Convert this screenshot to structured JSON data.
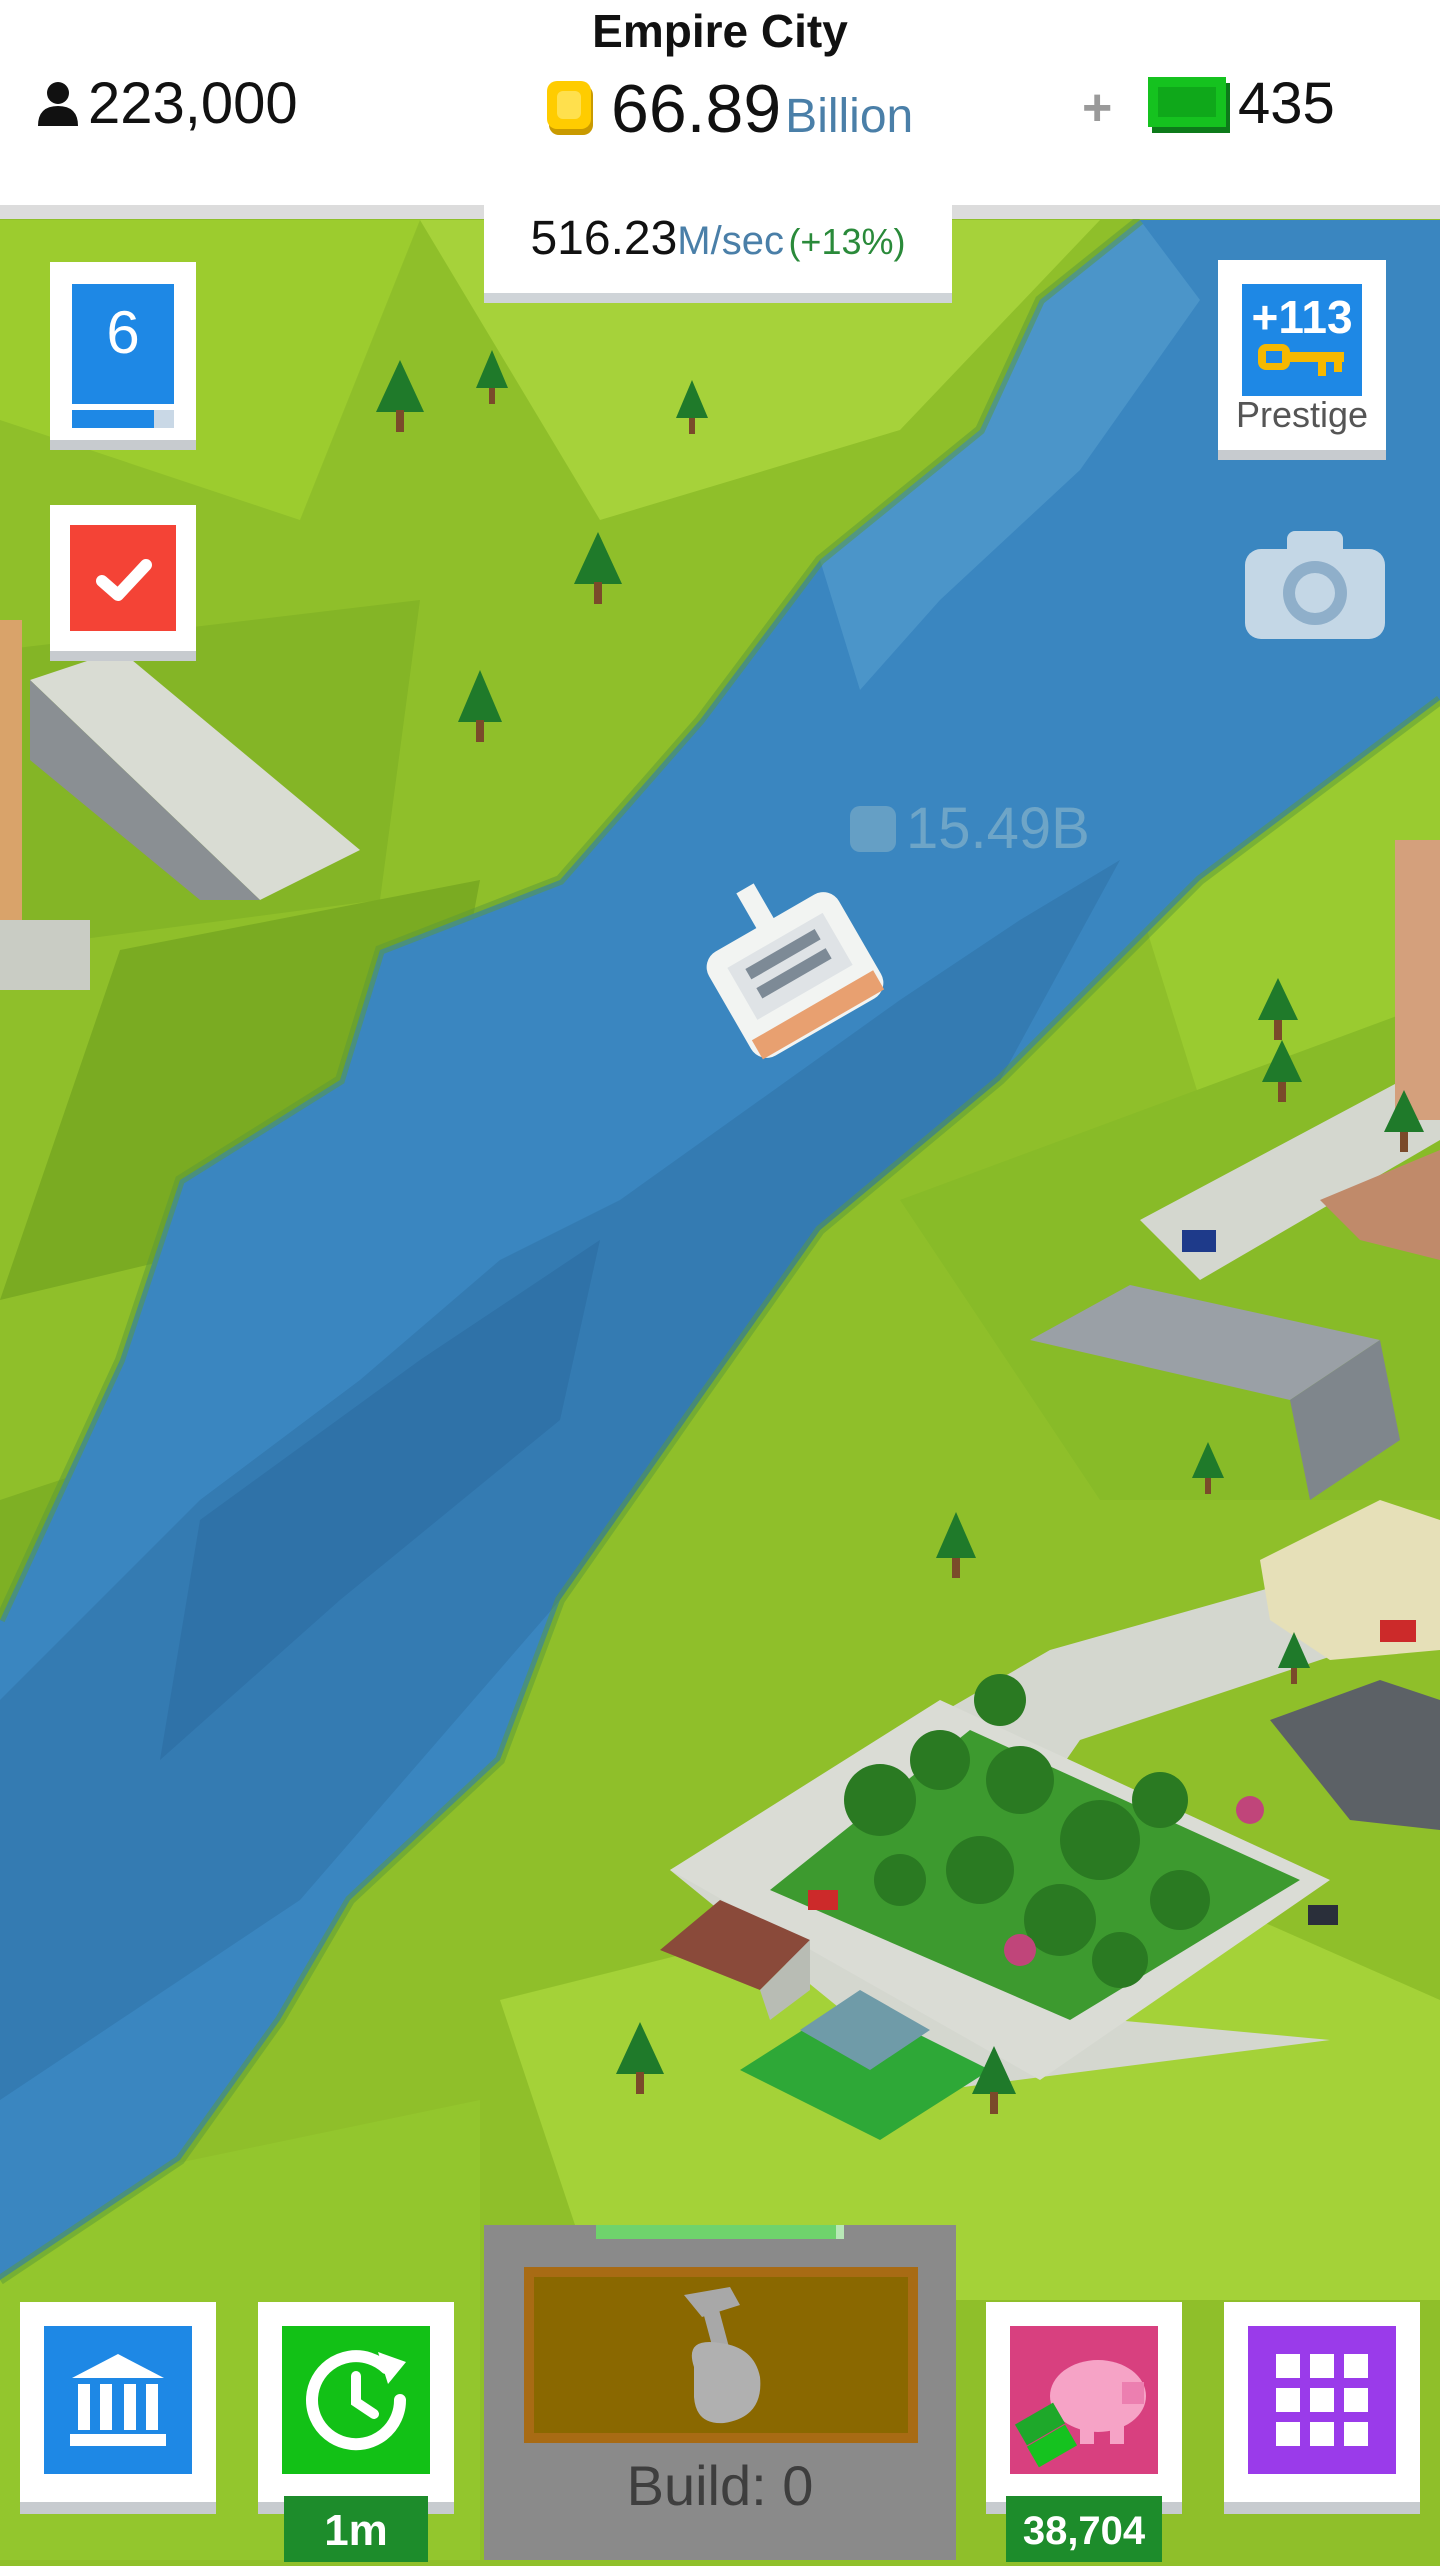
{
  "header": {
    "city_name": "Empire City",
    "population": "223,000",
    "money_amount": "66.89",
    "money_unit": "Billion",
    "cash_add": "+",
    "cash": "435"
  },
  "income": {
    "amount": "516.23",
    "unit": "M/sec",
    "bonus": "(+13%)"
  },
  "level": {
    "value": "6",
    "progress": 0.8
  },
  "prestige": {
    "value": "+113",
    "label": "Prestige"
  },
  "floating_income": "15.49B",
  "bottom": {
    "timer_label": "1m",
    "piggy_value": "38,704",
    "build_label": "Build: 0"
  },
  "icons": {
    "population": "person-icon",
    "money": "coin-icon",
    "cash": "cash-bill-icon",
    "level_task": "checkmark-icon",
    "prestige": "key-icon",
    "camera": "camera-icon",
    "museum": "museum-icon",
    "timer": "clock-refresh-icon",
    "build": "hammer-hand-icon",
    "piggy": "piggy-bank-icon",
    "grid": "grid-menu-icon"
  },
  "colors": {
    "blue": "#1e88e5",
    "green": "#12c116",
    "red": "#f44336",
    "purple": "#9a3bea",
    "pink": "#d8407f",
    "water": "#3a86c0",
    "grass": "#8fbf2a"
  }
}
